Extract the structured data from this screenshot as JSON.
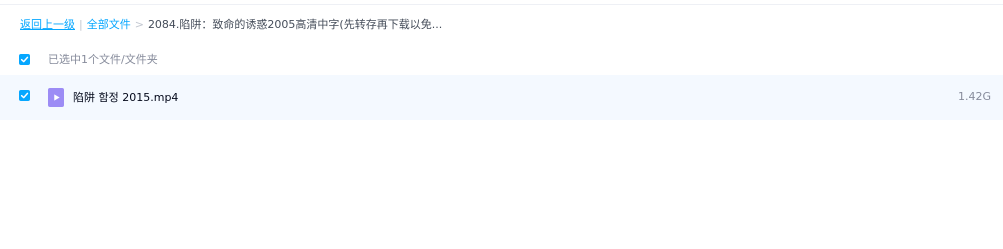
{
  "breadcrumb": {
    "back_label": "返回上一级",
    "separator": "|",
    "all_files_label": "全部文件",
    "arrow": ">",
    "current_folder": "2084.陷阱：致命的诱惑2005高清中字(先转存再下载以免..."
  },
  "selection": {
    "status_text": "已选中1个文件/文件夹",
    "checked": true
  },
  "files": [
    {
      "name": "陷阱 함정 2015.mp4",
      "size": "1.42G",
      "type": "video",
      "icon": "video-file-icon",
      "checked": true
    }
  ],
  "colors": {
    "accent": "#06a7ff",
    "row_highlight": "#f4f9ff",
    "video_icon": "#9c8cf5",
    "muted_text": "#878c9c"
  }
}
